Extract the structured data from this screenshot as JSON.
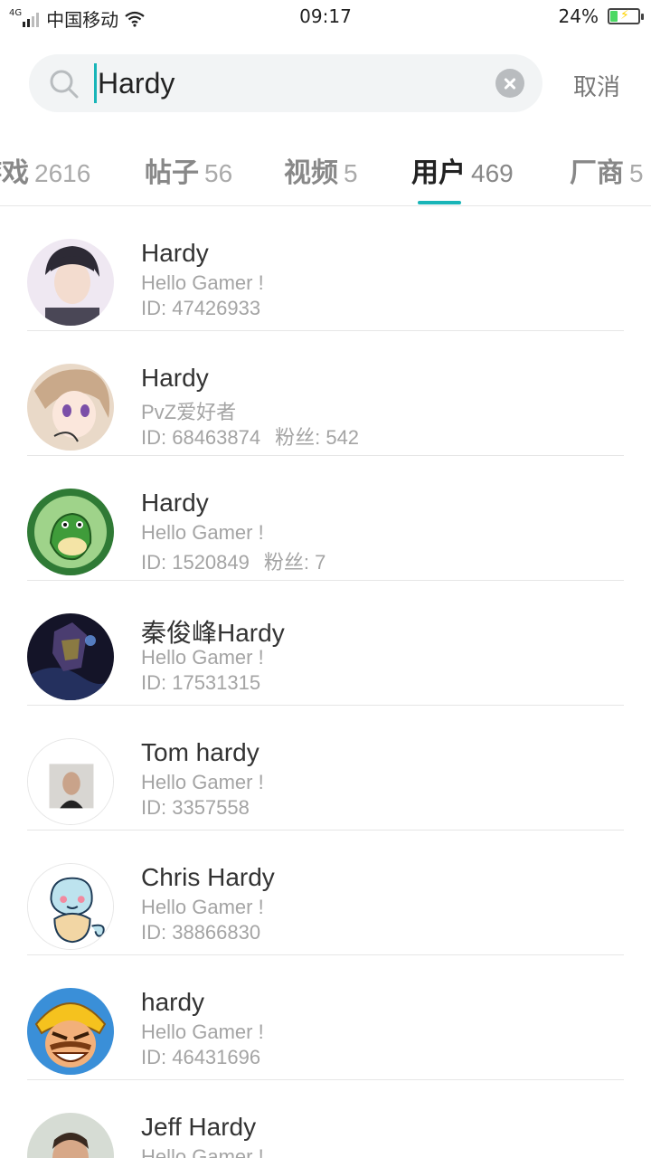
{
  "status_bar": {
    "network": "4G",
    "carrier": "中国移动",
    "time": "09:17",
    "battery": "24%",
    "battery_level": 0.24
  },
  "search": {
    "query": "Hardy",
    "cancel_label": "取消",
    "accent_color": "#19b5b8"
  },
  "tabs": [
    {
      "label": "游戏",
      "count": "2616"
    },
    {
      "label": "帖子",
      "count": "56"
    },
    {
      "label": "视频",
      "count": "5"
    },
    {
      "label": "用户",
      "count": "469",
      "active": true
    },
    {
      "label": "厂商",
      "count": "5"
    }
  ],
  "users": [
    {
      "name": "Hardy",
      "bio": "Hello Gamer !",
      "id": "ID: 47426933",
      "fans": ""
    },
    {
      "name": "Hardy",
      "bio": "PvZ爱好者",
      "id": "ID: 68463874",
      "fans": "粉丝: 542"
    },
    {
      "name": "Hardy",
      "bio": "Hello Gamer !",
      "id": "ID: 1520849",
      "fans": "粉丝: 7"
    },
    {
      "name": "秦俊峰Hardy",
      "bio": "Hello Gamer !",
      "id": "ID: 17531315",
      "fans": ""
    },
    {
      "name": "Tom hardy",
      "bio": "Hello Gamer !",
      "id": "ID: 3357558",
      "fans": ""
    },
    {
      "name": "Chris Hardy",
      "bio": "Hello Gamer !",
      "id": "ID: 38866830",
      "fans": ""
    },
    {
      "name": "hardy",
      "bio": "Hello Gamer !",
      "id": "ID: 46431696",
      "fans": ""
    },
    {
      "name": "Jeff Hardy",
      "bio": "Hello Gamer !",
      "id": "",
      "fans": ""
    }
  ]
}
